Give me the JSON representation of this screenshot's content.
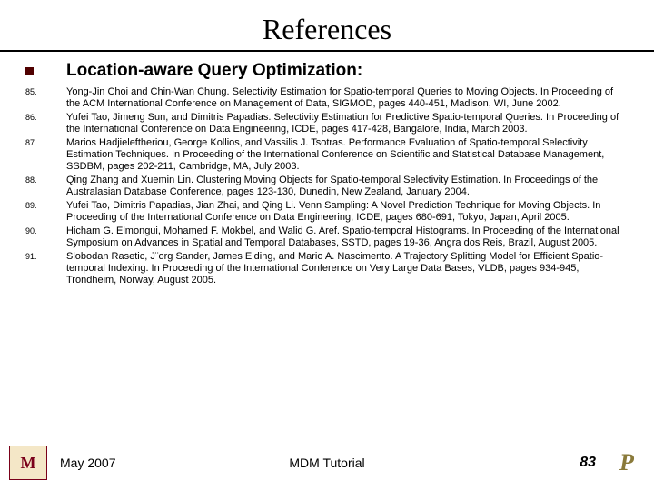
{
  "title": "References",
  "section_heading": "Location-aware Query Optimization:",
  "refs": [
    {
      "num": "85.",
      "text": "Yong-Jin Choi and Chin-Wan Chung. Selectivity Estimation for Spatio-temporal Queries to Moving Objects. In Proceeding of the ACM International Conference on Management of Data, SIGMOD, pages 440-451, Madison, WI, June 2002."
    },
    {
      "num": "86.",
      "text": "Yufei Tao, Jimeng Sun, and Dimitris Papadias. Selectivity Estimation for Predictive Spatio-temporal Queries. In Proceeding of the International Conference on Data Engineering, ICDE, pages 417-428, Bangalore, India, March 2003."
    },
    {
      "num": "87.",
      "text": "Marios Hadjieleftheriou, George Kollios, and Vassilis J. Tsotras. Performance Evaluation of Spatio-temporal Selectivity Estimation Techniques. In Proceeding of the International Conference on Scientific and Statistical Database Management, SSDBM, pages 202-211, Cambridge, MA, July 2003."
    },
    {
      "num": "88.",
      "text": "Qing Zhang and Xuemin Lin. Clustering Moving Objects for Spatio-temporal Selectivity Estimation. In Proceedings of the Australasian Database Conference, pages 123-130, Dunedin, New Zealand, January 2004."
    },
    {
      "num": "89.",
      "text": "Yufei Tao, Dimitris Papadias, Jian Zhai, and Qing Li. Venn Sampling: A Novel Prediction Technique for Moving Objects. In Proceeding of the International Conference on Data Engineering, ICDE, pages 680-691, Tokyo, Japan, April 2005."
    },
    {
      "num": "90.",
      "text": "Hicham G. Elmongui, Mohamed F. Mokbel, and Walid G. Aref. Spatio-temporal Histograms. In Proceeding of the International Symposium on Advances in Spatial and Temporal Databases, SSTD, pages 19-36, Angra dos Reis, Brazil, August 2005."
    },
    {
      "num": "91.",
      "text": "Slobodan Rasetic, J¨org Sander, James Elding, and Mario A. Nascimento. A Trajectory Splitting Model for Efficient Spatio-temporal Indexing. In Proceeding of the International Conference on Very Large Data Bases, VLDB, pages 934-945, Trondheim, Norway, August 2005."
    }
  ],
  "footer": {
    "date": "May 2007",
    "center": "MDM Tutorial",
    "page": "83",
    "logo_left": "M",
    "logo_right": "P"
  }
}
